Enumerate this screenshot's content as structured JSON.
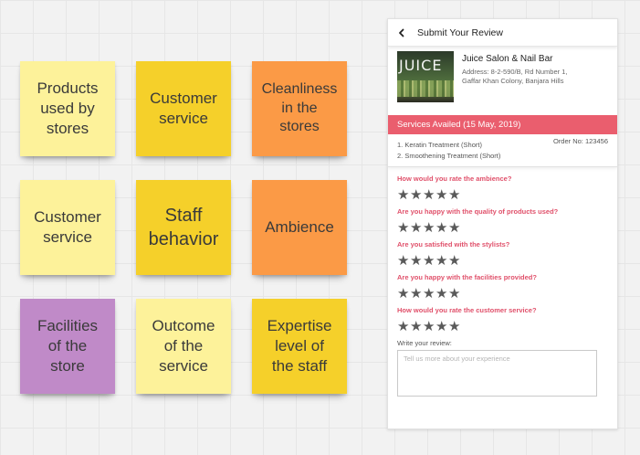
{
  "notes": [
    {
      "lines": [
        "Products",
        "used by",
        "stores"
      ]
    },
    {
      "lines": [
        "Customer",
        "service"
      ]
    },
    {
      "lines": [
        "Cleanliness",
        "in the",
        "stores"
      ]
    },
    {
      "lines": [
        "Customer",
        "service"
      ]
    },
    {
      "lines": [
        "Staff",
        "behavior"
      ]
    },
    {
      "lines": [
        "Ambience"
      ]
    },
    {
      "lines": [
        "Facilities",
        "of the",
        "store"
      ]
    },
    {
      "lines": [
        "Outcome",
        "of the",
        "service"
      ]
    },
    {
      "lines": [
        "Expertise",
        "level of",
        "the staff"
      ]
    }
  ],
  "note_colors": {
    "pale": "#fdf29a",
    "yellow": "#f5d02a",
    "orange": "#fb9a46",
    "purple": "#c08ac8"
  },
  "review": {
    "back_icon": "chevron-left-icon",
    "title": "Submit Your Review",
    "salon_logo_text": "JUICE",
    "salon_name": "Juice Salon & Nail Bar",
    "address_line1": "Address: 8-2-590/B, Rd Number 1,",
    "address_line2": "Gaffar Khan Colony, Banjara Hills",
    "services_header": "Services Availed (15 May, 2019)",
    "services": [
      "1. Keratin Treatment (Short)",
      "2. Smoothening Treatment (Short)"
    ],
    "order_no": "Order No: 123456",
    "accent_color": "#ea5e6e",
    "questions": [
      {
        "text": "How would you rate the ambience?",
        "rating": 0
      },
      {
        "text": "Are you happy with the quality of products used?",
        "rating": 0
      },
      {
        "text": "Are you satisfied with the stylists?",
        "rating": 0
      },
      {
        "text": "Are you happy with the facilities provided?",
        "rating": 0
      },
      {
        "text": "How would you rate the customer service?",
        "rating": 0
      }
    ],
    "star_glyph": "★",
    "review_label": "Write your review:",
    "review_value": "",
    "review_placeholder": "Tell us more about your experience"
  }
}
